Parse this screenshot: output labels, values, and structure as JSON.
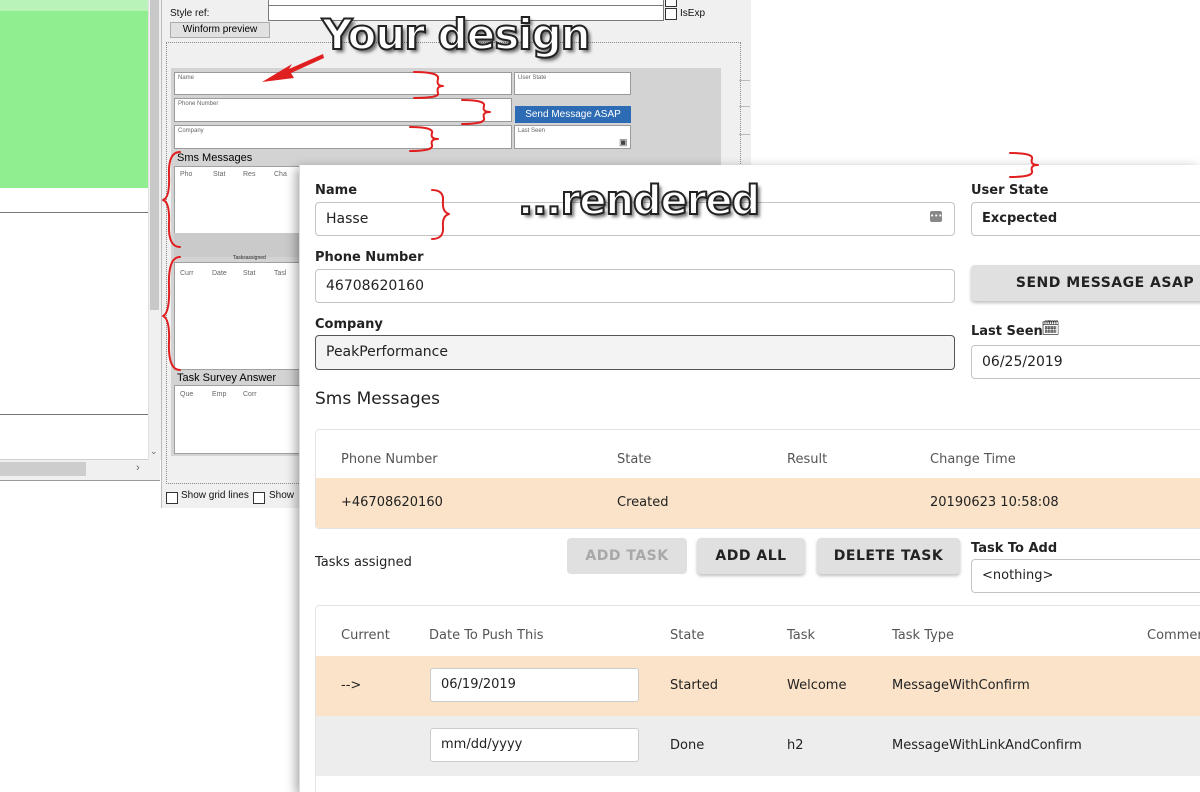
{
  "designer": {
    "style_ref_label": "Style ref:",
    "winform_preview_button": "Winform preview",
    "is_exp_label": "IsExp",
    "show_grid_lines_label": "Show grid lines",
    "show_label": "Show",
    "mini_form": {
      "name_placeholder": "Name",
      "user_state_placeholder": "User State",
      "phone_placeholder": "Phone Number",
      "send_button": "Send Message ASAP",
      "company_placeholder": "Company",
      "last_seen_placeholder": "Last Seen",
      "sms_messages_label": "Sms Messages",
      "sms_columns": [
        "Pho",
        "Stat",
        "Res",
        "Cha"
      ],
      "tasks_assigned_label": "Tasksassigned",
      "task_columns": [
        "Curr",
        "Date",
        "Stat",
        "Tasl"
      ],
      "task_survey_label": "Task Survey Answer",
      "survey_columns": [
        "Que",
        "Emp",
        "Corr"
      ]
    }
  },
  "annotations": {
    "your_design": "Your design",
    "rendered": "...rendered"
  },
  "rendered": {
    "name_label": "Name",
    "name_value": "Hasse",
    "user_state_label": "User State",
    "user_state_value": "Excpected",
    "phone_label": "Phone Number",
    "phone_value": "46708620160",
    "send_button": "SEND MESSAGE ASAP",
    "company_label": "Company",
    "company_value": "PeakPerformance",
    "last_seen_label": "Last Seen",
    "last_seen_value": "06/25/2019",
    "sms_title": "Sms Messages",
    "sms_table": {
      "headers": [
        "Phone Number",
        "State",
        "Result",
        "Change Time"
      ],
      "rows": [
        {
          "phone": "+46708620160",
          "state": "Created",
          "result": "",
          "change_time": "20190623 10:58:08"
        }
      ]
    },
    "tasks_assigned_label": "Tasks assigned",
    "add_task_button": "ADD TASK",
    "add_all_button": "ADD ALL",
    "delete_task_button": "DELETE TASK",
    "task_to_add_label": "Task To Add",
    "task_to_add_value": "<nothing>",
    "tasks_table": {
      "headers": [
        "Current",
        "Date To Push This",
        "State",
        "Task",
        "Task Type",
        "Commer"
      ],
      "rows": [
        {
          "current": "-->",
          "date": "06/19/2019",
          "state": "Started",
          "task": "Welcome",
          "task_type": "MessageWithConfirm"
        },
        {
          "current": "",
          "date": "mm/dd/yyyy",
          "state": "Done",
          "task": "h2",
          "task_type": "MessageWithLinkAndConfirm"
        }
      ]
    }
  },
  "colors": {
    "highlight_row": "#fae3c8",
    "alt_row": "#ededed",
    "send_button_blue": "#2d6cb5",
    "annotation_red": "#e02020",
    "green_panel": "#90ee90"
  }
}
